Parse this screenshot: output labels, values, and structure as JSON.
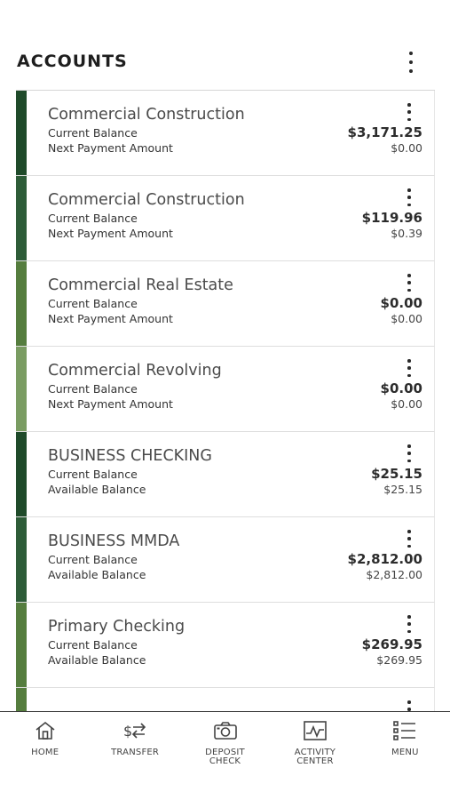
{
  "header": {
    "title": "ACCOUNTS"
  },
  "accounts": [
    {
      "name": "Commercial Construction",
      "label1": "Current Balance",
      "label2": "Next Payment Amount",
      "value1": "$3,171.25",
      "value2": "$0.00",
      "color": "#1f4a2a"
    },
    {
      "name": "Commercial Construction",
      "label1": "Current Balance",
      "label2": "Next Payment Amount",
      "value1": "$119.96",
      "value2": "$0.39",
      "color": "#2e5c38"
    },
    {
      "name": "Commercial Real Estate",
      "label1": "Current Balance",
      "label2": "Next Payment Amount",
      "value1": "$0.00",
      "value2": "$0.00",
      "color": "#557d3e"
    },
    {
      "name": "Commercial Revolving",
      "label1": "Current Balance",
      "label2": "Next Payment Amount",
      "value1": "$0.00",
      "value2": "$0.00",
      "color": "#7a9c62"
    },
    {
      "name": "BUSINESS CHECKING",
      "label1": "Current Balance",
      "label2": "Available Balance",
      "value1": "$25.15",
      "value2": "$25.15",
      "color": "#1f4a2a"
    },
    {
      "name": "BUSINESS MMDA",
      "label1": "Current Balance",
      "label2": "Available Balance",
      "value1": "$2,812.00",
      "value2": "$2,812.00",
      "color": "#2e5c38"
    },
    {
      "name": "Primary Checking",
      "label1": "Current Balance",
      "label2": "Available Balance",
      "value1": "$269.95",
      "value2": "$269.95",
      "color": "#557d3e"
    }
  ],
  "nav": {
    "home": "HOME",
    "transfer": "TRANSFER",
    "deposit": "DEPOSIT\nCHECK",
    "activity": "ACTIVITY\nCENTER",
    "menu": "MENU"
  }
}
